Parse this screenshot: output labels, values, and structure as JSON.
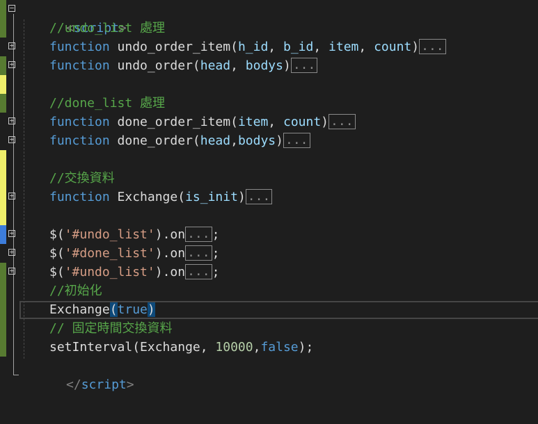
{
  "editor": {
    "colors": {
      "background": "#1e1e1e",
      "keyword": "#569cd6",
      "comment": "#57a64a",
      "string": "#d69d85",
      "number": "#b5cea8",
      "change_saved": "#577b31",
      "change_unsaved": "#efef6b",
      "change_reverted": "#3d7ddb"
    },
    "lines": [
      {
        "open_tag": "<",
        "tag_name": "script",
        "close_tag": ">"
      },
      {
        "comment": "//undo_list 處理"
      },
      {
        "kw": "function",
        "name": " undo_order_item(",
        "p1": "h_id",
        "sep1": ", ",
        "p2": "b_id",
        "sep2": ", ",
        "p3": "item",
        "sep3": ", ",
        "p4": "count",
        "close": ")",
        "collapsed": "..."
      },
      {
        "kw": "function",
        "name": " undo_order(",
        "p1": "head",
        "sep1": ", ",
        "p2": "bodys",
        "close": ")",
        "collapsed": "..."
      },
      {
        "comment": "//done_list 處理"
      },
      {
        "kw": "function",
        "name": " done_order_item(",
        "p1": "item",
        "sep1": ", ",
        "p2": "count",
        "close": ")",
        "collapsed": "..."
      },
      {
        "kw": "function",
        "name": " done_order(",
        "p1": "head",
        "sep1": ",",
        "p2": "bodys",
        "close": ")",
        "collapsed": "..."
      },
      {
        "comment": "//交換資料"
      },
      {
        "kw": "function",
        "name": " Exchange(",
        "p1": "is_init",
        "close": ")",
        "collapsed": "..."
      },
      {
        "prefix": "$(",
        "str": "'#undo_list'",
        "suffix": ").on",
        "collapsed": "...",
        "end": ";"
      },
      {
        "prefix": "$(",
        "str": "'#done_list'",
        "suffix": ").on",
        "collapsed": "...",
        "end": ";"
      },
      {
        "prefix": "$(",
        "str": "'#undo_list'",
        "suffix": ").on",
        "collapsed": "...",
        "end": ";"
      },
      {
        "comment": "//初始化"
      },
      {
        "name": "Exchange",
        "open": "(",
        "arg": "true",
        "close": ")"
      },
      {
        "comment": "// 固定時間交換資料"
      },
      {
        "name": "setInterval(Exchange, ",
        "num": "10000",
        "sep": ",",
        "arg": "false",
        "end": ");"
      },
      {
        "open_tag": "</",
        "tag_name": "script",
        "close_tag": ">"
      }
    ]
  }
}
